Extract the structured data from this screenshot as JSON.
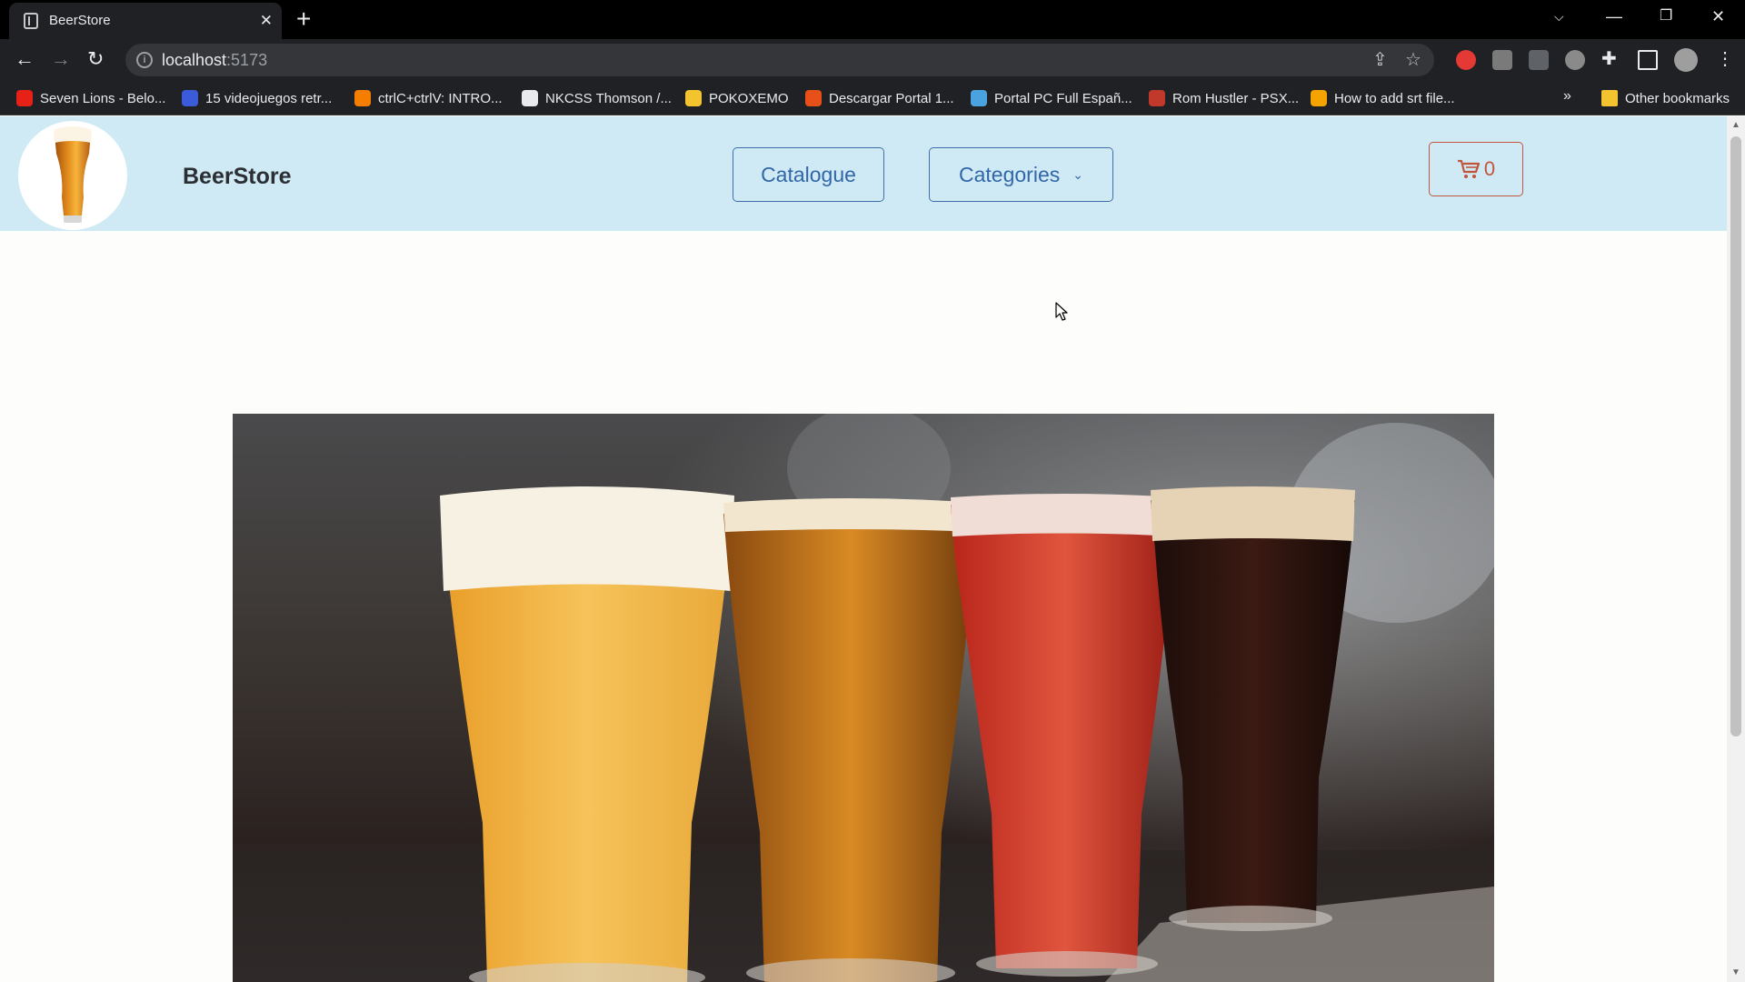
{
  "browser": {
    "tab_title": "BeerStore",
    "url_host": "localhost",
    "url_port": ":5173",
    "other_bookmarks": "Other bookmarks",
    "bookmarks": [
      {
        "label": "Seven Lions - Belo...",
        "icon_color": "#e62117"
      },
      {
        "label": "15 videojuegos retr...",
        "icon_color": "#3b5bdb"
      },
      {
        "label": "ctrlC+ctrlV: INTRO...",
        "icon_color": "#f57d00"
      },
      {
        "label": "NKCSS Thomson /...",
        "icon_color": "#e8eaed"
      },
      {
        "label": "POKOXEMO",
        "icon_color": "#f4c430"
      },
      {
        "label": "Descargar Portal 1...",
        "icon_color": "#e8501a"
      },
      {
        "label": "Portal PC Full Españ...",
        "icon_color": "#4aa3df"
      },
      {
        "label": "Rom Hustler - PSX...",
        "icon_color": "#c0392b"
      },
      {
        "label": "How to add srt file...",
        "icon_color": "#f4a300"
      }
    ]
  },
  "site": {
    "brand": "BeerStore",
    "nav": {
      "catalogue": "Catalogue",
      "categories": "Categories"
    },
    "cart_count": "0"
  },
  "colors": {
    "navbar_bg": "#cfeaf4",
    "nav_accent": "#3167a8",
    "cart_accent": "#c2553c",
    "page_bg": "#fdfdfb"
  }
}
